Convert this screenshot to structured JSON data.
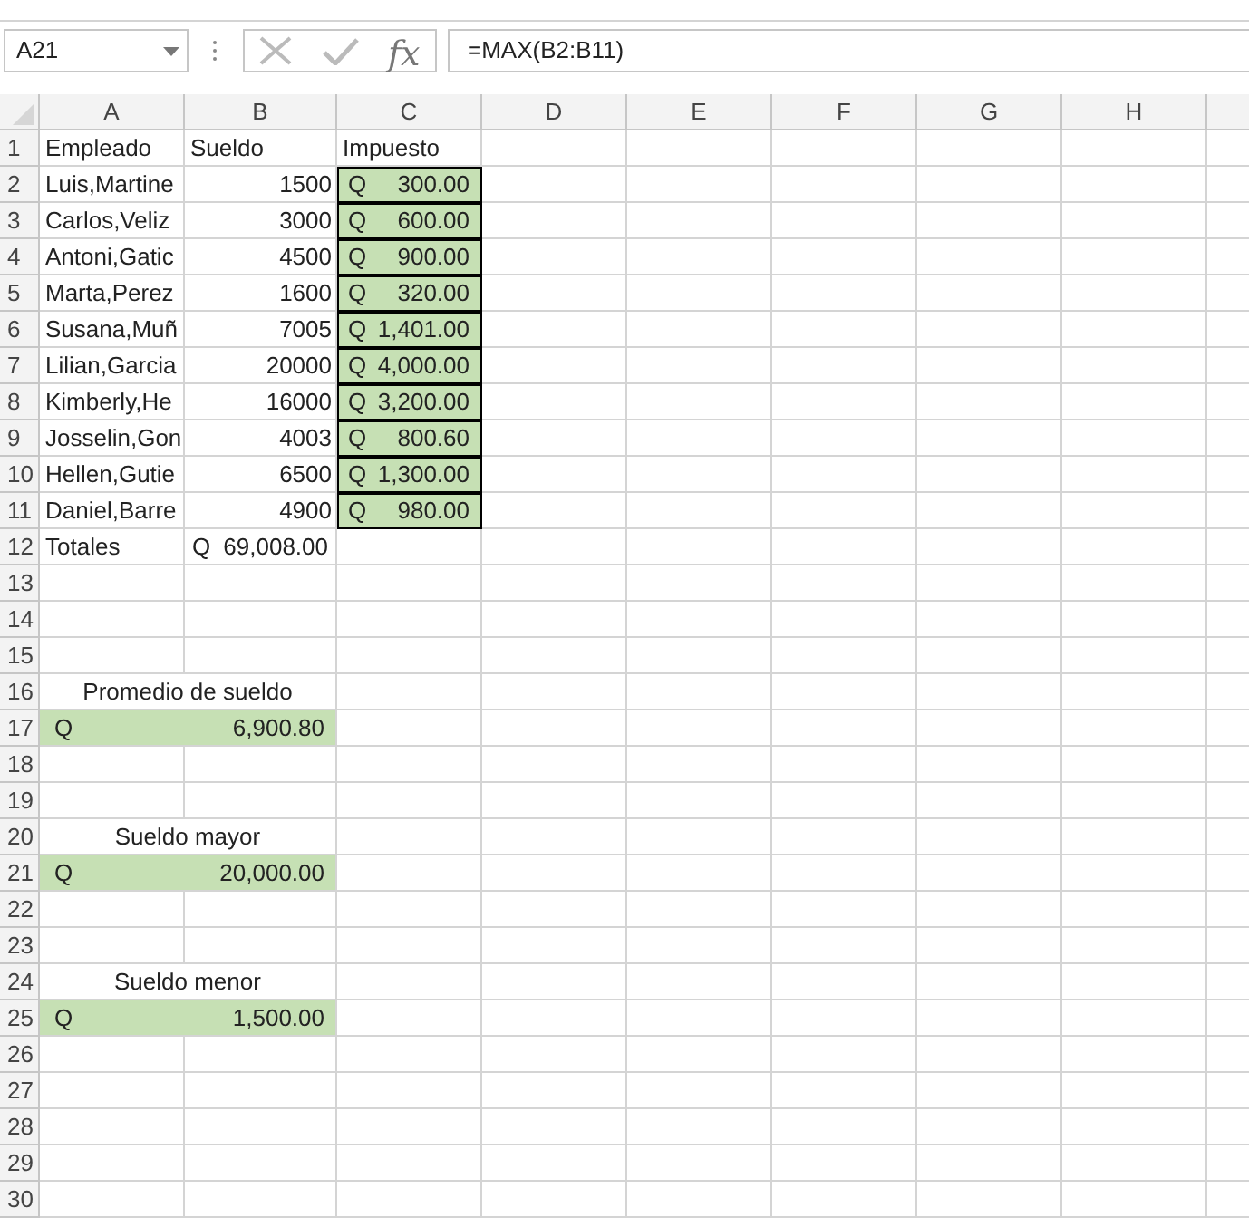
{
  "name_box": {
    "value": "A21"
  },
  "formula_bar": {
    "function_label": "fx",
    "value": "=MAX(B2:B11)"
  },
  "columns": [
    "A",
    "B",
    "C",
    "D",
    "E",
    "F",
    "G",
    "H"
  ],
  "rows": [
    {
      "number": "1",
      "cells": [
        {
          "kind": "text",
          "text": "Empleado"
        },
        {
          "kind": "text",
          "text": "Sueldo"
        },
        {
          "kind": "text",
          "text": "Impuesto"
        }
      ]
    },
    {
      "number": "2",
      "cells": [
        {
          "kind": "text",
          "text": "Luis,Martine"
        },
        {
          "kind": "number",
          "text": "1500"
        },
        {
          "kind": "accounting",
          "symbol": "Q",
          "amount": "300.00",
          "highlighted": true,
          "bordered": true
        }
      ]
    },
    {
      "number": "3",
      "cells": [
        {
          "kind": "text",
          "text": "Carlos,Veliz"
        },
        {
          "kind": "number",
          "text": "3000"
        },
        {
          "kind": "accounting",
          "symbol": "Q",
          "amount": "600.00",
          "highlighted": true,
          "bordered": true
        }
      ]
    },
    {
      "number": "4",
      "cells": [
        {
          "kind": "text",
          "text": "Antoni,Gatic"
        },
        {
          "kind": "number",
          "text": "4500"
        },
        {
          "kind": "accounting",
          "symbol": "Q",
          "amount": "900.00",
          "highlighted": true,
          "bordered": true
        }
      ]
    },
    {
      "number": "5",
      "cells": [
        {
          "kind": "text",
          "text": "Marta,Perez"
        },
        {
          "kind": "number",
          "text": "1600"
        },
        {
          "kind": "accounting",
          "symbol": "Q",
          "amount": "320.00",
          "highlighted": true,
          "bordered": true
        }
      ]
    },
    {
      "number": "6",
      "cells": [
        {
          "kind": "text",
          "text": "Susana,Muñ"
        },
        {
          "kind": "number",
          "text": "7005"
        },
        {
          "kind": "accounting",
          "symbol": "Q",
          "amount": "1,401.00",
          "highlighted": true,
          "bordered": true
        }
      ]
    },
    {
      "number": "7",
      "cells": [
        {
          "kind": "text",
          "text": "Lilian,Garcia"
        },
        {
          "kind": "number",
          "text": "20000"
        },
        {
          "kind": "accounting",
          "symbol": "Q",
          "amount": "4,000.00",
          "highlighted": true,
          "bordered": true
        }
      ]
    },
    {
      "number": "8",
      "cells": [
        {
          "kind": "text",
          "text": "Kimberly,He"
        },
        {
          "kind": "number",
          "text": "16000"
        },
        {
          "kind": "accounting",
          "symbol": "Q",
          "amount": "3,200.00",
          "highlighted": true,
          "bordered": true
        }
      ]
    },
    {
      "number": "9",
      "cells": [
        {
          "kind": "text",
          "text": "Josselin,Gon"
        },
        {
          "kind": "number",
          "text": "4003"
        },
        {
          "kind": "accounting",
          "symbol": "Q",
          "amount": "800.60",
          "highlighted": true,
          "bordered": true
        }
      ]
    },
    {
      "number": "10",
      "cells": [
        {
          "kind": "text",
          "text": "Hellen,Gutie"
        },
        {
          "kind": "number",
          "text": "6500"
        },
        {
          "kind": "accounting",
          "symbol": "Q",
          "amount": "1,300.00",
          "highlighted": true,
          "bordered": true
        }
      ]
    },
    {
      "number": "11",
      "cells": [
        {
          "kind": "text",
          "text": "Daniel,Barre"
        },
        {
          "kind": "number",
          "text": "4900"
        },
        {
          "kind": "accounting",
          "symbol": "Q",
          "amount": "980.00",
          "highlighted": true,
          "bordered": true
        }
      ]
    },
    {
      "number": "12",
      "cells": [
        {
          "kind": "text",
          "text": "Totales"
        },
        {
          "kind": "accounting",
          "symbol": "Q",
          "amount": "69,008.00",
          "highlighted": false,
          "bordered": false
        }
      ]
    },
    {
      "number": "13",
      "cells": []
    },
    {
      "number": "14",
      "cells": []
    },
    {
      "number": "15",
      "cells": []
    },
    {
      "number": "16",
      "cells": [
        {
          "kind": "merged_title",
          "text": "Promedio de sueldo"
        }
      ]
    },
    {
      "number": "17",
      "cells": [
        {
          "kind": "merged_accounting",
          "symbol": "Q",
          "amount": "6,900.80",
          "highlighted": true
        }
      ]
    },
    {
      "number": "18",
      "cells": []
    },
    {
      "number": "19",
      "cells": []
    },
    {
      "number": "20",
      "cells": [
        {
          "kind": "merged_title",
          "text": "Sueldo mayor"
        }
      ]
    },
    {
      "number": "21",
      "cells": [
        {
          "kind": "merged_accounting",
          "symbol": "Q",
          "amount": "20,000.00",
          "highlighted": true
        }
      ]
    },
    {
      "number": "22",
      "cells": []
    },
    {
      "number": "23",
      "cells": []
    },
    {
      "number": "24",
      "cells": [
        {
          "kind": "merged_title",
          "text": "Sueldo menor"
        }
      ]
    },
    {
      "number": "25",
      "cells": [
        {
          "kind": "merged_accounting",
          "symbol": "Q",
          "amount": "1,500.00",
          "highlighted": true
        }
      ]
    },
    {
      "number": "26",
      "cells": []
    },
    {
      "number": "27",
      "cells": []
    },
    {
      "number": "28",
      "cells": []
    },
    {
      "number": "29",
      "cells": []
    },
    {
      "number": "30",
      "cells": []
    }
  ]
}
